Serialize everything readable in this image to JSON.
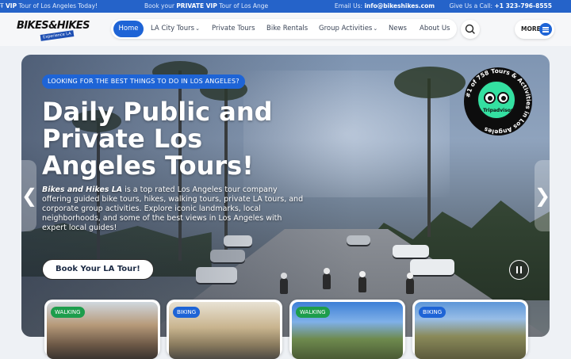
{
  "topbar": {
    "msg1_icon": "Ŧ",
    "msg1_bold": "VIP",
    "msg1_text": " Tour of Los Angeles Today!",
    "msg2_pre": "Book your ",
    "msg2_bold": "PRIVATE VIP",
    "msg2_post": " Tour of Los Ange",
    "email_label": "Email Us:",
    "email": "info@bikeshikes.com",
    "phone_label": "Give Us a Call:",
    "phone": "+1 323-796-8555"
  },
  "logo": {
    "main": "BIKES&HIKES",
    "sub": "Experience LA"
  },
  "nav": {
    "items": [
      {
        "label": "Home",
        "dropdown": false
      },
      {
        "label": "LA City Tours",
        "dropdown": true
      },
      {
        "label": "Private Tours",
        "dropdown": false
      },
      {
        "label": "Bike Rentals",
        "dropdown": false
      },
      {
        "label": "Group Activities",
        "dropdown": true
      },
      {
        "label": "News",
        "dropdown": false
      },
      {
        "label": "About Us",
        "dropdown": false
      }
    ],
    "more_label": "MORE",
    "search_icon": "search-icon",
    "menu_icon": "hamburger-icon"
  },
  "hero": {
    "pill": "LOOKING FOR THE BEST THINGS TO DO IN LOS ANGELES?",
    "headline": "Daily Public and Private Los Angeles Tours!",
    "desc_brand": "Bikes and Hikes LA",
    "desc_text": " is a top rated Los Angeles tour company offering guided bike tours, hikes, walking tours, private LA tours, and corporate group activities. Explore iconic landmarks, local neighborhoods, and some of the best views in Los Angeles with expert local guides!",
    "cta": "Book Your LA Tour!",
    "prev_arrow": "❮",
    "next_arrow": "❯",
    "badge": {
      "name": "Tripadvisor",
      "ring_text": "#1 of 758 Tours & Activities in Los Angeles"
    }
  },
  "cards": [
    {
      "tag": "WALKING",
      "color": "#1d9d4c"
    },
    {
      "tag": "BIKING",
      "color": "#1e64d6"
    },
    {
      "tag": "WALKING",
      "color": "#1d9d4c"
    },
    {
      "tag": "BIKING",
      "color": "#1e64d6"
    }
  ],
  "colors": {
    "brand_blue": "#1e64d6",
    "walking_green": "#1d9d4c",
    "tripadvisor_green": "#34e0a1"
  }
}
